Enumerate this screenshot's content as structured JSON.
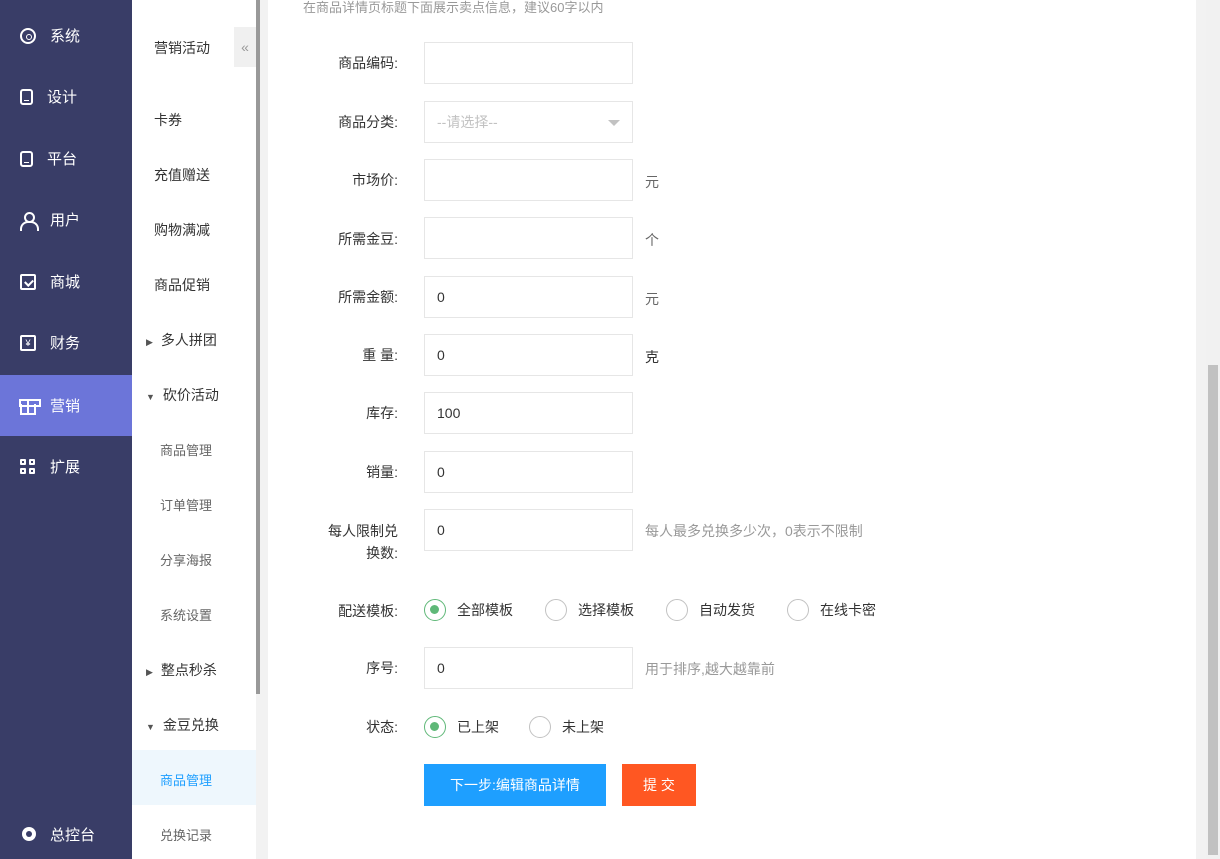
{
  "main_nav": {
    "items": [
      {
        "label": "系统",
        "icon": "gear-icon"
      },
      {
        "label": "设计",
        "icon": "tablet-icon"
      },
      {
        "label": "平台",
        "icon": "tablet-icon"
      },
      {
        "label": "用户",
        "icon": "user-icon"
      },
      {
        "label": "商城",
        "icon": "shop-icon"
      },
      {
        "label": "财务",
        "icon": "yen-icon"
      },
      {
        "label": "营销",
        "icon": "gift-icon",
        "active": true
      },
      {
        "label": "扩展",
        "icon": "grid-icon"
      }
    ],
    "bottom": {
      "label": "总控台",
      "icon": "cog-icon"
    },
    "active_color": "#6c75d9",
    "bg_color": "#393d67"
  },
  "sub_nav": {
    "title": "营销活动",
    "collapse_symbol": "«",
    "items": [
      {
        "label": "卡券"
      },
      {
        "label": "充值赠送"
      },
      {
        "label": "购物满减"
      },
      {
        "label": "商品促销"
      },
      {
        "label": "多人拼团",
        "caret": "▶"
      },
      {
        "label": "砍价活动",
        "caret": "▼"
      },
      {
        "label": "商品管理"
      },
      {
        "label": "订单管理"
      },
      {
        "label": "分享海报"
      },
      {
        "label": "系统设置"
      },
      {
        "label": "整点秒杀",
        "caret": "▶"
      },
      {
        "label": "金豆兑换",
        "caret": "▼"
      },
      {
        "label": "商品管理",
        "current": true
      },
      {
        "label": "兑换记录"
      }
    ]
  },
  "form": {
    "top_tip": "在商品详情页标题下面展示卖点信息，建议60字以内",
    "product_code": {
      "label": "商品编码:",
      "value": ""
    },
    "category": {
      "label": "商品分类:",
      "placeholder": "--请选择--"
    },
    "market_price": {
      "label": "市场价:",
      "value": "",
      "unit": "元"
    },
    "gold_beans": {
      "label": "所需金豆:",
      "value": "",
      "unit": "个"
    },
    "amount": {
      "label": "所需金额:",
      "value": "0",
      "unit": "元"
    },
    "weight": {
      "label": "重 量:",
      "value": "0",
      "unit": "克"
    },
    "stock": {
      "label": "库存:",
      "value": "100"
    },
    "sales": {
      "label": "销量:",
      "value": "0"
    },
    "limit": {
      "label_line1": "每人限制兑",
      "label_line2": "换数:",
      "value": "0",
      "hint": "每人最多兑换多少次，0表示不限制"
    },
    "delivery": {
      "label": "配送模板:",
      "options": [
        "全部模板",
        "选择模板",
        "自动发货",
        "在线卡密"
      ],
      "selected": "全部模板"
    },
    "sort": {
      "label": "序号:",
      "value": "0",
      "hint": "用于排序,越大越靠前"
    },
    "status": {
      "label": "状态:",
      "options": [
        "已上架",
        "未上架"
      ],
      "selected": "已上架"
    },
    "next_button": "下一步:编辑商品详情",
    "submit_button": "提 交",
    "accent_colors": {
      "primary": "#1e9fff",
      "danger": "#ff5722",
      "radio": "#5fb878"
    }
  }
}
